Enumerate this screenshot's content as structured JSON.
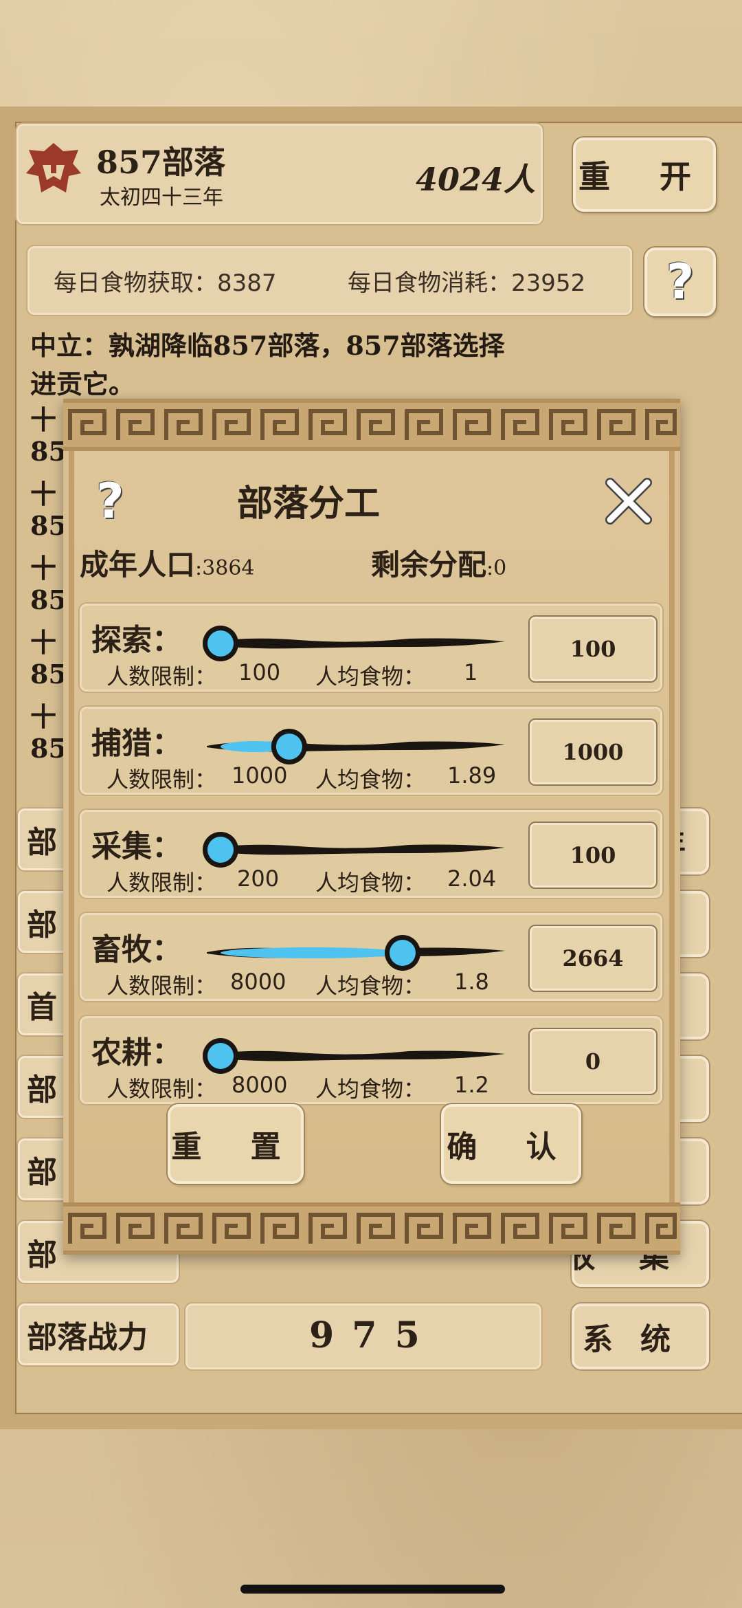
{
  "header": {
    "tribe_name": "857部落",
    "year": "太初四十三年",
    "population": "4024人",
    "restart_label": "重 开"
  },
  "food": {
    "gain": "每日食物获取：8387",
    "consume": "每日食物消耗：23952"
  },
  "help_icon": "?",
  "log": [
    "中立：孰湖降临857部落，857部落选择",
    "进贡它。",
    "十",
    "85",
    "十",
    "85",
    "十",
    "85",
    "十",
    "85",
    "十",
    "85"
  ],
  "left_menu": [
    "部",
    "部",
    "首",
    "部",
    "部",
    "部",
    "部落战力"
  ],
  "right_menu": [
    "年",
    "",
    "",
    "",
    "",
    "",
    "系统"
  ],
  "right_bottom_partial": "收 集",
  "combat_power": "9 7 5",
  "modal": {
    "title": "部落分工",
    "adult_label": "成年人口",
    "adult_value": ":3864",
    "remain_label": "剩余分配",
    "remain_value": ":0",
    "reset_label": "重 置",
    "confirm_label": "确 认",
    "jobs": [
      {
        "name": "探索：",
        "limit_label": "人数限制：",
        "limit": "100",
        "food_label": "人均食物：",
        "food": "1",
        "value": "100",
        "fill": 0.0
      },
      {
        "name": "捕猎：",
        "limit_label": "人数限制：",
        "limit": "1000",
        "food_label": "人均食物：",
        "food": "1.89",
        "value": "1000",
        "fill": 0.26
      },
      {
        "name": "采集：",
        "limit_label": "人数限制：",
        "limit": "200",
        "food_label": "人均食物：",
        "food": "2.04",
        "value": "100",
        "fill": 0.0
      },
      {
        "name": "畜牧：",
        "limit_label": "人数限制：",
        "limit": "8000",
        "food_label": "人均食物：",
        "food": "1.8",
        "value": "2664",
        "fill": 0.69
      },
      {
        "name": "农耕：",
        "limit_label": "人数限制：",
        "limit": "8000",
        "food_label": "人均食物：",
        "food": "1.2",
        "value": "0",
        "fill": 0.0
      }
    ]
  },
  "colors": {
    "accent_blue": "#4fc3f0",
    "ink": "#1a1510",
    "paper": "#d9c39a"
  }
}
